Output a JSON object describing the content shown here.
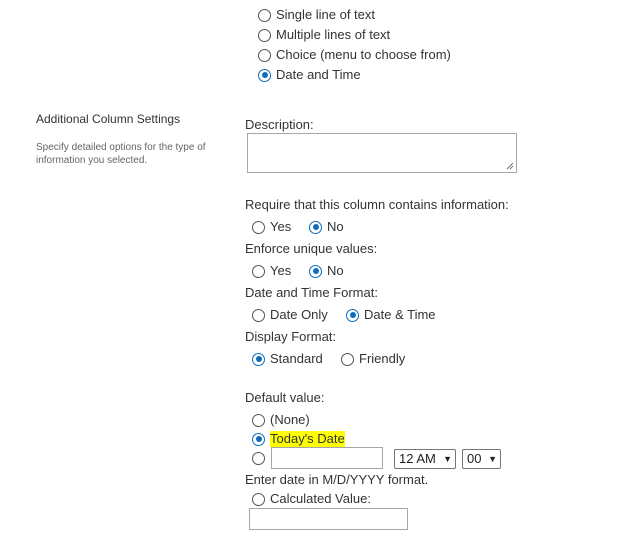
{
  "column_type": {
    "options": [
      {
        "label": "Single line of text",
        "selected": false
      },
      {
        "label": "Multiple lines of text",
        "selected": false
      },
      {
        "label": "Choice (menu to choose from)",
        "selected": false
      },
      {
        "label": "Date and Time",
        "selected": true
      }
    ]
  },
  "additional_settings": {
    "title": "Additional Column Settings",
    "description": "Specify detailed options for the type of information you selected."
  },
  "description_field": {
    "label": "Description:",
    "value": ""
  },
  "require": {
    "label": "Require that this column contains information:",
    "yes": "Yes",
    "no": "No",
    "selected": "No"
  },
  "unique": {
    "label": "Enforce unique values:",
    "yes": "Yes",
    "no": "No",
    "selected": "No"
  },
  "format": {
    "label": "Date and Time Format:",
    "date_only": "Date Only",
    "date_time": "Date & Time",
    "selected": "Date & Time"
  },
  "display": {
    "label": "Display Format:",
    "standard": "Standard",
    "friendly": "Friendly",
    "selected": "Standard"
  },
  "default_value": {
    "label": "Default value:",
    "none": "(None)",
    "today": "Today's Date",
    "selected": "Today's Date",
    "highlight_color": "#ffff00",
    "date_input_value": "",
    "hour": "12 AM",
    "minute": "00",
    "hint": "Enter date in M/D/YYYY format.",
    "calculated": "Calculated Value:",
    "calculated_value": ""
  },
  "colors": {
    "accent": "#0f6cbd",
    "text": "#333333",
    "muted": "#666666"
  }
}
